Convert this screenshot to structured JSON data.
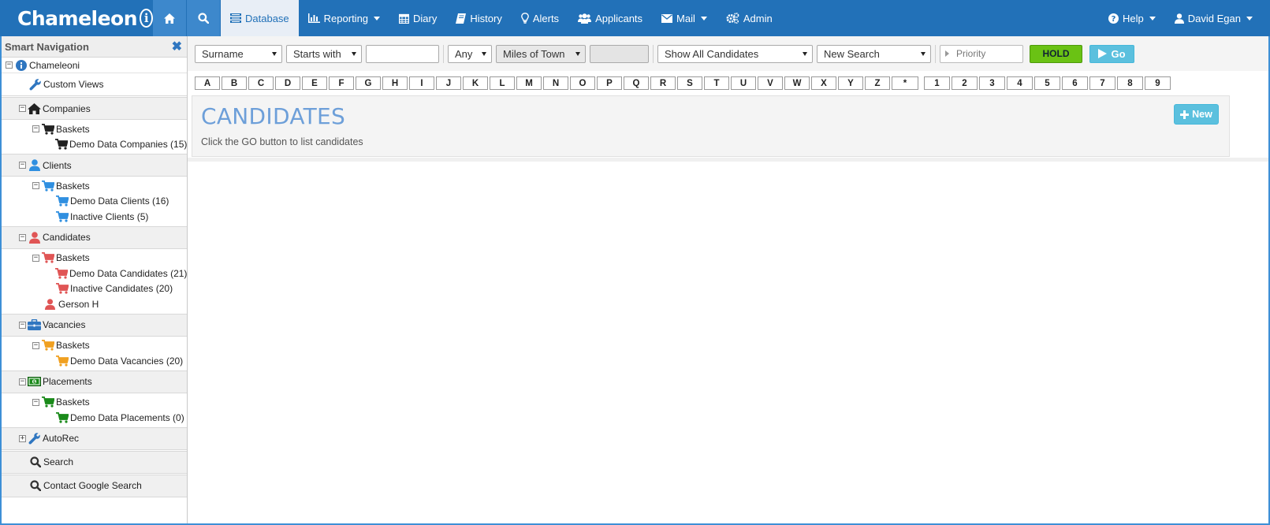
{
  "app": {
    "brand": "Chameleon",
    "brand_icon": "i"
  },
  "nav": {
    "home_icon": "home-icon",
    "search_icon": "search-icon",
    "items": [
      {
        "label": "Database",
        "icon": "database-icon",
        "active": true
      },
      {
        "label": "Reporting",
        "icon": "bar-chart-icon",
        "caret": true
      },
      {
        "label": "Diary",
        "icon": "calendar-icon"
      },
      {
        "label": "History",
        "icon": "book-icon"
      },
      {
        "label": "Alerts",
        "icon": "lightbulb-icon"
      },
      {
        "label": "Applicants",
        "icon": "users-icon"
      },
      {
        "label": "Mail",
        "icon": "envelope-icon",
        "caret": true
      },
      {
        "label": "Admin",
        "icon": "cogs-icon"
      }
    ],
    "help_label": "Help",
    "user_label": "David Egan"
  },
  "sidebar": {
    "title": "Smart Navigation",
    "root": "Chameleoni",
    "custom_views": "Custom Views",
    "companies": {
      "label": "Companies",
      "baskets": "Baskets",
      "items": [
        "Demo Data Companies (15)"
      ]
    },
    "clients": {
      "label": "Clients",
      "baskets": "Baskets",
      "items": [
        "Demo Data Clients (16)",
        "Inactive Clients (5)"
      ]
    },
    "candidates": {
      "label": "Candidates",
      "baskets": "Baskets",
      "items": [
        "Demo Data Candidates (21)",
        "Inactive Candidates (20)"
      ],
      "person": "Gerson H"
    },
    "vacancies": {
      "label": "Vacancies",
      "baskets": "Baskets",
      "items": [
        "Demo Data Vacancies (20)"
      ]
    },
    "placements": {
      "label": "Placements",
      "baskets": "Baskets",
      "items": [
        "Demo Data Placements (0)"
      ]
    },
    "autorec": "AutoRec",
    "search": "Search",
    "google": "Contact Google Search"
  },
  "toolbar": {
    "field_select": "Surname",
    "match_select": "Starts with",
    "search_value": "",
    "any_select": "Any",
    "miles_select": "Miles of Town",
    "town_value": "",
    "show_select": "Show All Candidates",
    "new_search_select": "New Search",
    "priority_placeholder": "Priority",
    "hold_label": "HOLD",
    "go_label": "Go"
  },
  "letters": [
    "A",
    "B",
    "C",
    "D",
    "E",
    "F",
    "G",
    "H",
    "I",
    "J",
    "K",
    "L",
    "M",
    "N",
    "O",
    "P",
    "Q",
    "R",
    "S",
    "T",
    "U",
    "V",
    "W",
    "X",
    "Y",
    "Z",
    "*",
    "1",
    "2",
    "3",
    "4",
    "5",
    "6",
    "7",
    "8",
    "9"
  ],
  "panel": {
    "title": "CANDIDATES",
    "subtitle": "Click the GO button to list candidates",
    "new_label": "New"
  },
  "colors": {
    "navbar": "#2271b8",
    "companies": "#222222",
    "clients": "#2f8fe0",
    "candidates": "#e05555",
    "vacancies": "#f0a020",
    "placements": "#1a8a1a",
    "hold": "#6ac214",
    "go": "#5bc0de"
  }
}
